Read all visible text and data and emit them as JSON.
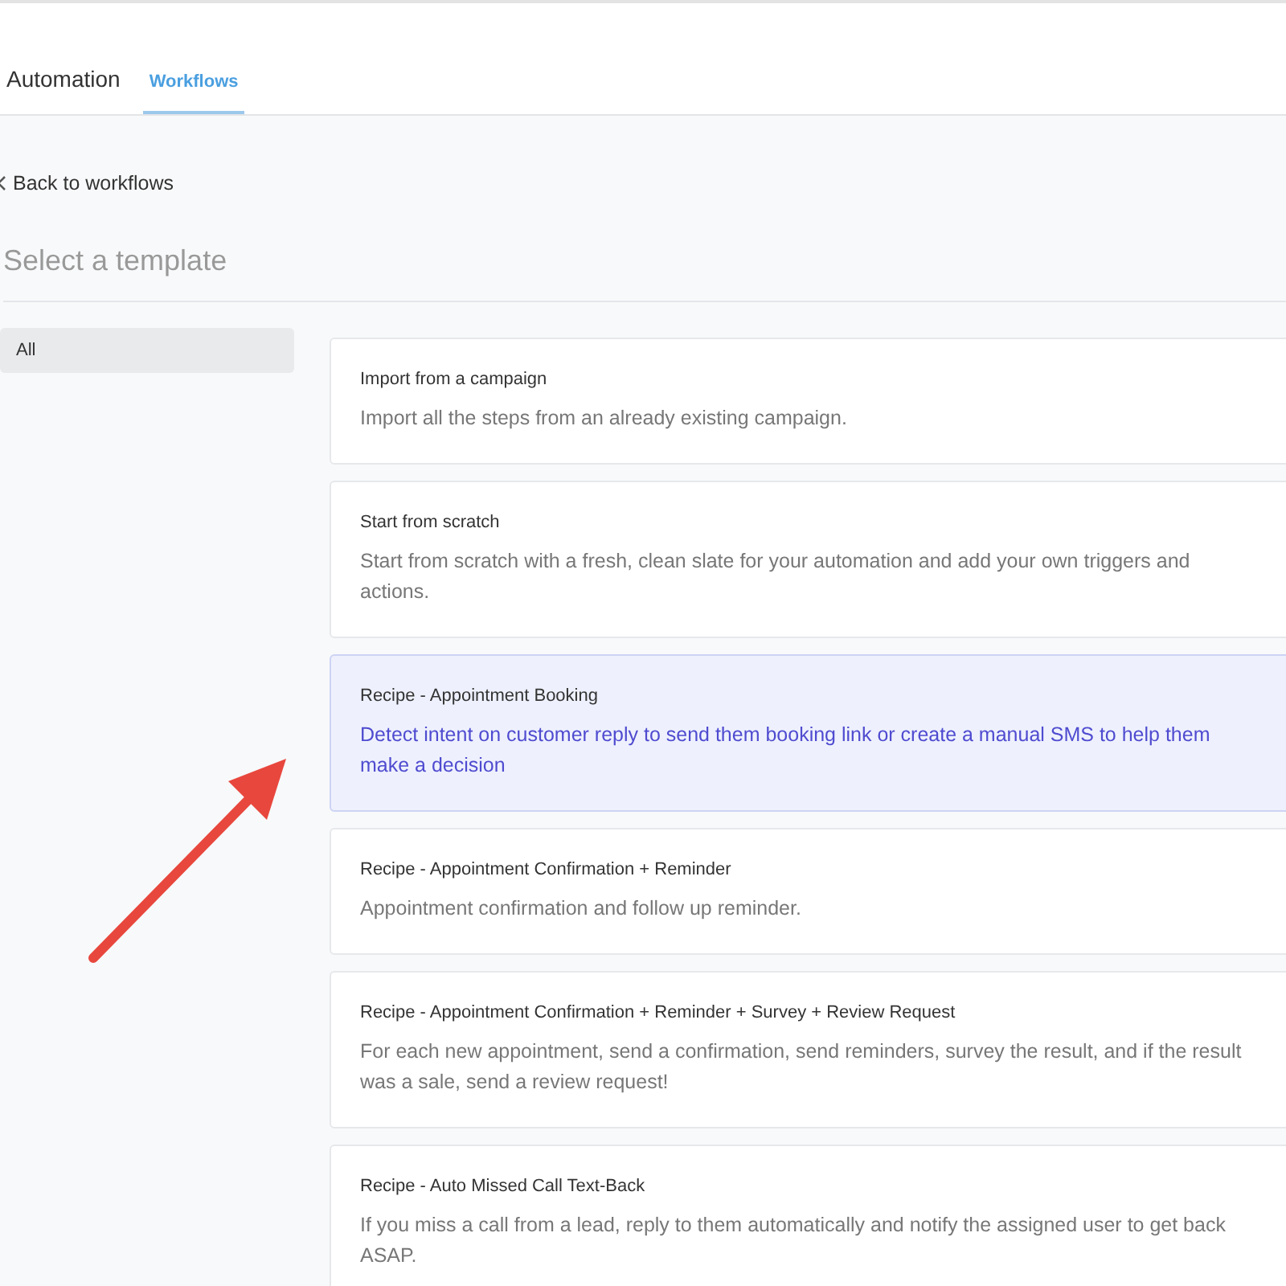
{
  "header": {
    "title": "Automation",
    "tabs": [
      {
        "label": "Workflows",
        "selected": true
      }
    ]
  },
  "back_link": "Back to workflows",
  "page_title": "Select a template",
  "sidebar": {
    "items": [
      {
        "label": "All",
        "selected": true
      }
    ]
  },
  "templates": [
    {
      "title": "Import from a campaign",
      "description": "Import all the steps from an already existing campaign.",
      "selected": false
    },
    {
      "title": "Start from scratch",
      "description": "Start from scratch with a fresh, clean slate for your automation and add your own triggers and actions.",
      "selected": false
    },
    {
      "title": "Recipe - Appointment Booking",
      "description": "Detect intent on customer reply to send them booking link or create a manual SMS to help them make a decision",
      "selected": true
    },
    {
      "title": "Recipe - Appointment Confirmation + Reminder",
      "description": "Appointment confirmation and follow up reminder.",
      "selected": false
    },
    {
      "title": "Recipe - Appointment Confirmation + Reminder + Survey + Review Request",
      "description": "For each new appointment, send a confirmation, send reminders, survey the result, and if the result was a sale, send a review request!",
      "selected": false
    },
    {
      "title": "Recipe - Auto Missed Call Text-Back",
      "description": "If you miss a call from a lead, reply to them automatically and notify the assigned user to get back ASAP.",
      "selected": false
    }
  ]
}
